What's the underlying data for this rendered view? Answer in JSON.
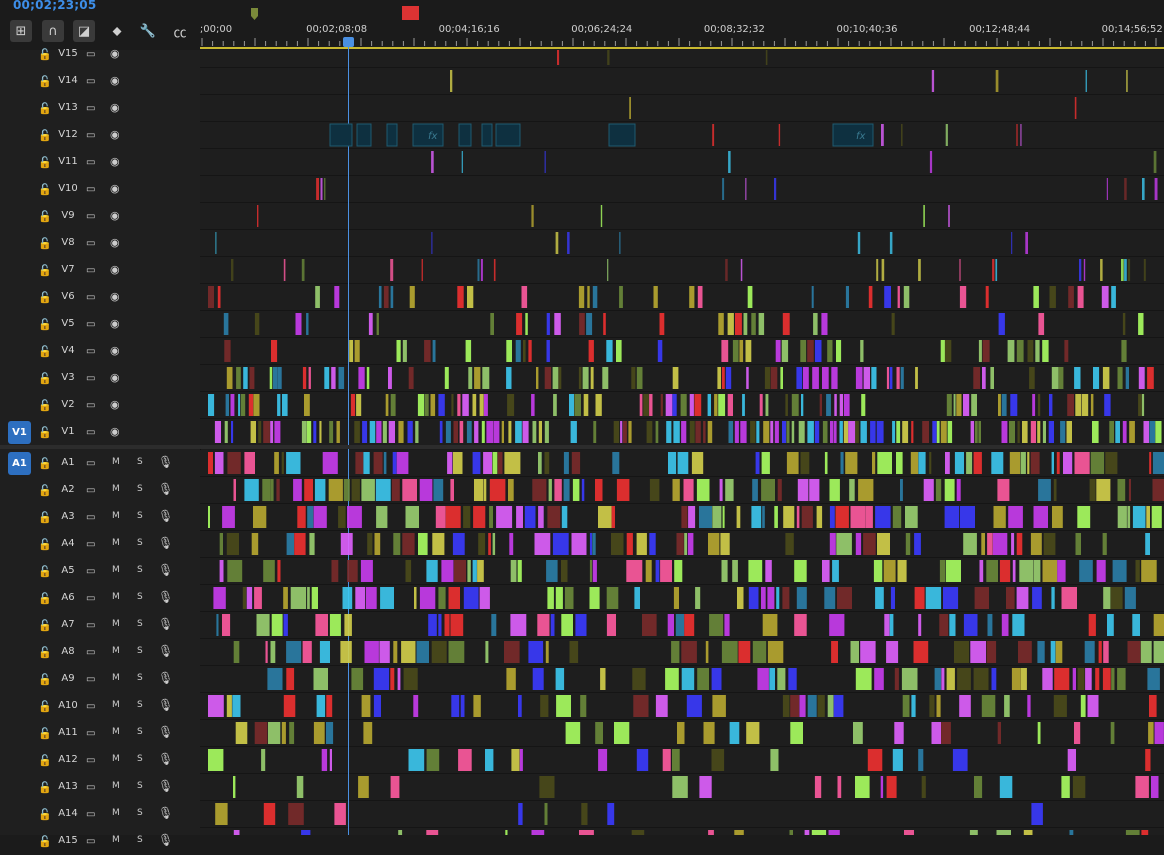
{
  "timecode": "00;02;23;05",
  "toolbar": {
    "tools": [
      {
        "name": "insert-overwrite-icon",
        "glyph": "⊞"
      },
      {
        "name": "snap-magnet-icon",
        "glyph": "∩"
      },
      {
        "name": "linked-selection-icon",
        "glyph": "◪"
      },
      {
        "name": "add-marker-icon",
        "glyph": "⬥"
      },
      {
        "name": "settings-wrench-icon",
        "glyph": "🔧"
      },
      {
        "name": "captions-icon",
        "glyph": "㏄"
      }
    ]
  },
  "ruler": {
    "labels": [
      ";00;00",
      "00;02;08;08",
      "00;04;16;16",
      "00;06;24;24",
      "00;08;32;32",
      "00;10;40;36",
      "00;12;48;44",
      "00;14;56;52"
    ]
  },
  "video_tracks": [
    "V15",
    "V14",
    "V13",
    "V12",
    "V11",
    "V10",
    "V9",
    "V8",
    "V7",
    "V6",
    "V5",
    "V4",
    "V3",
    "V2",
    "V1"
  ],
  "audio_tracks": [
    "A1",
    "A2",
    "A3",
    "A4",
    "A5",
    "A6",
    "A7",
    "A8",
    "A9",
    "A10",
    "A11",
    "A12",
    "A13",
    "A14",
    "A15"
  ],
  "targets": {
    "video": "V1",
    "audio": "A1"
  },
  "audio_buttons": {
    "mute": "M",
    "solo": "S"
  },
  "colors": {
    "accent": "#3d8ee8",
    "clip_palette": [
      "#c93cf0",
      "#e060ff",
      "#3cc8f0",
      "#2a7ea8",
      "#d4d04a",
      "#b8a830",
      "#f03030",
      "#9ad070",
      "#6a8a3a",
      "#4a4a1a",
      "#ff5aa0",
      "#7a2a2a",
      "#3a3aff",
      "#aaff60"
    ]
  },
  "fx_label": "fx"
}
